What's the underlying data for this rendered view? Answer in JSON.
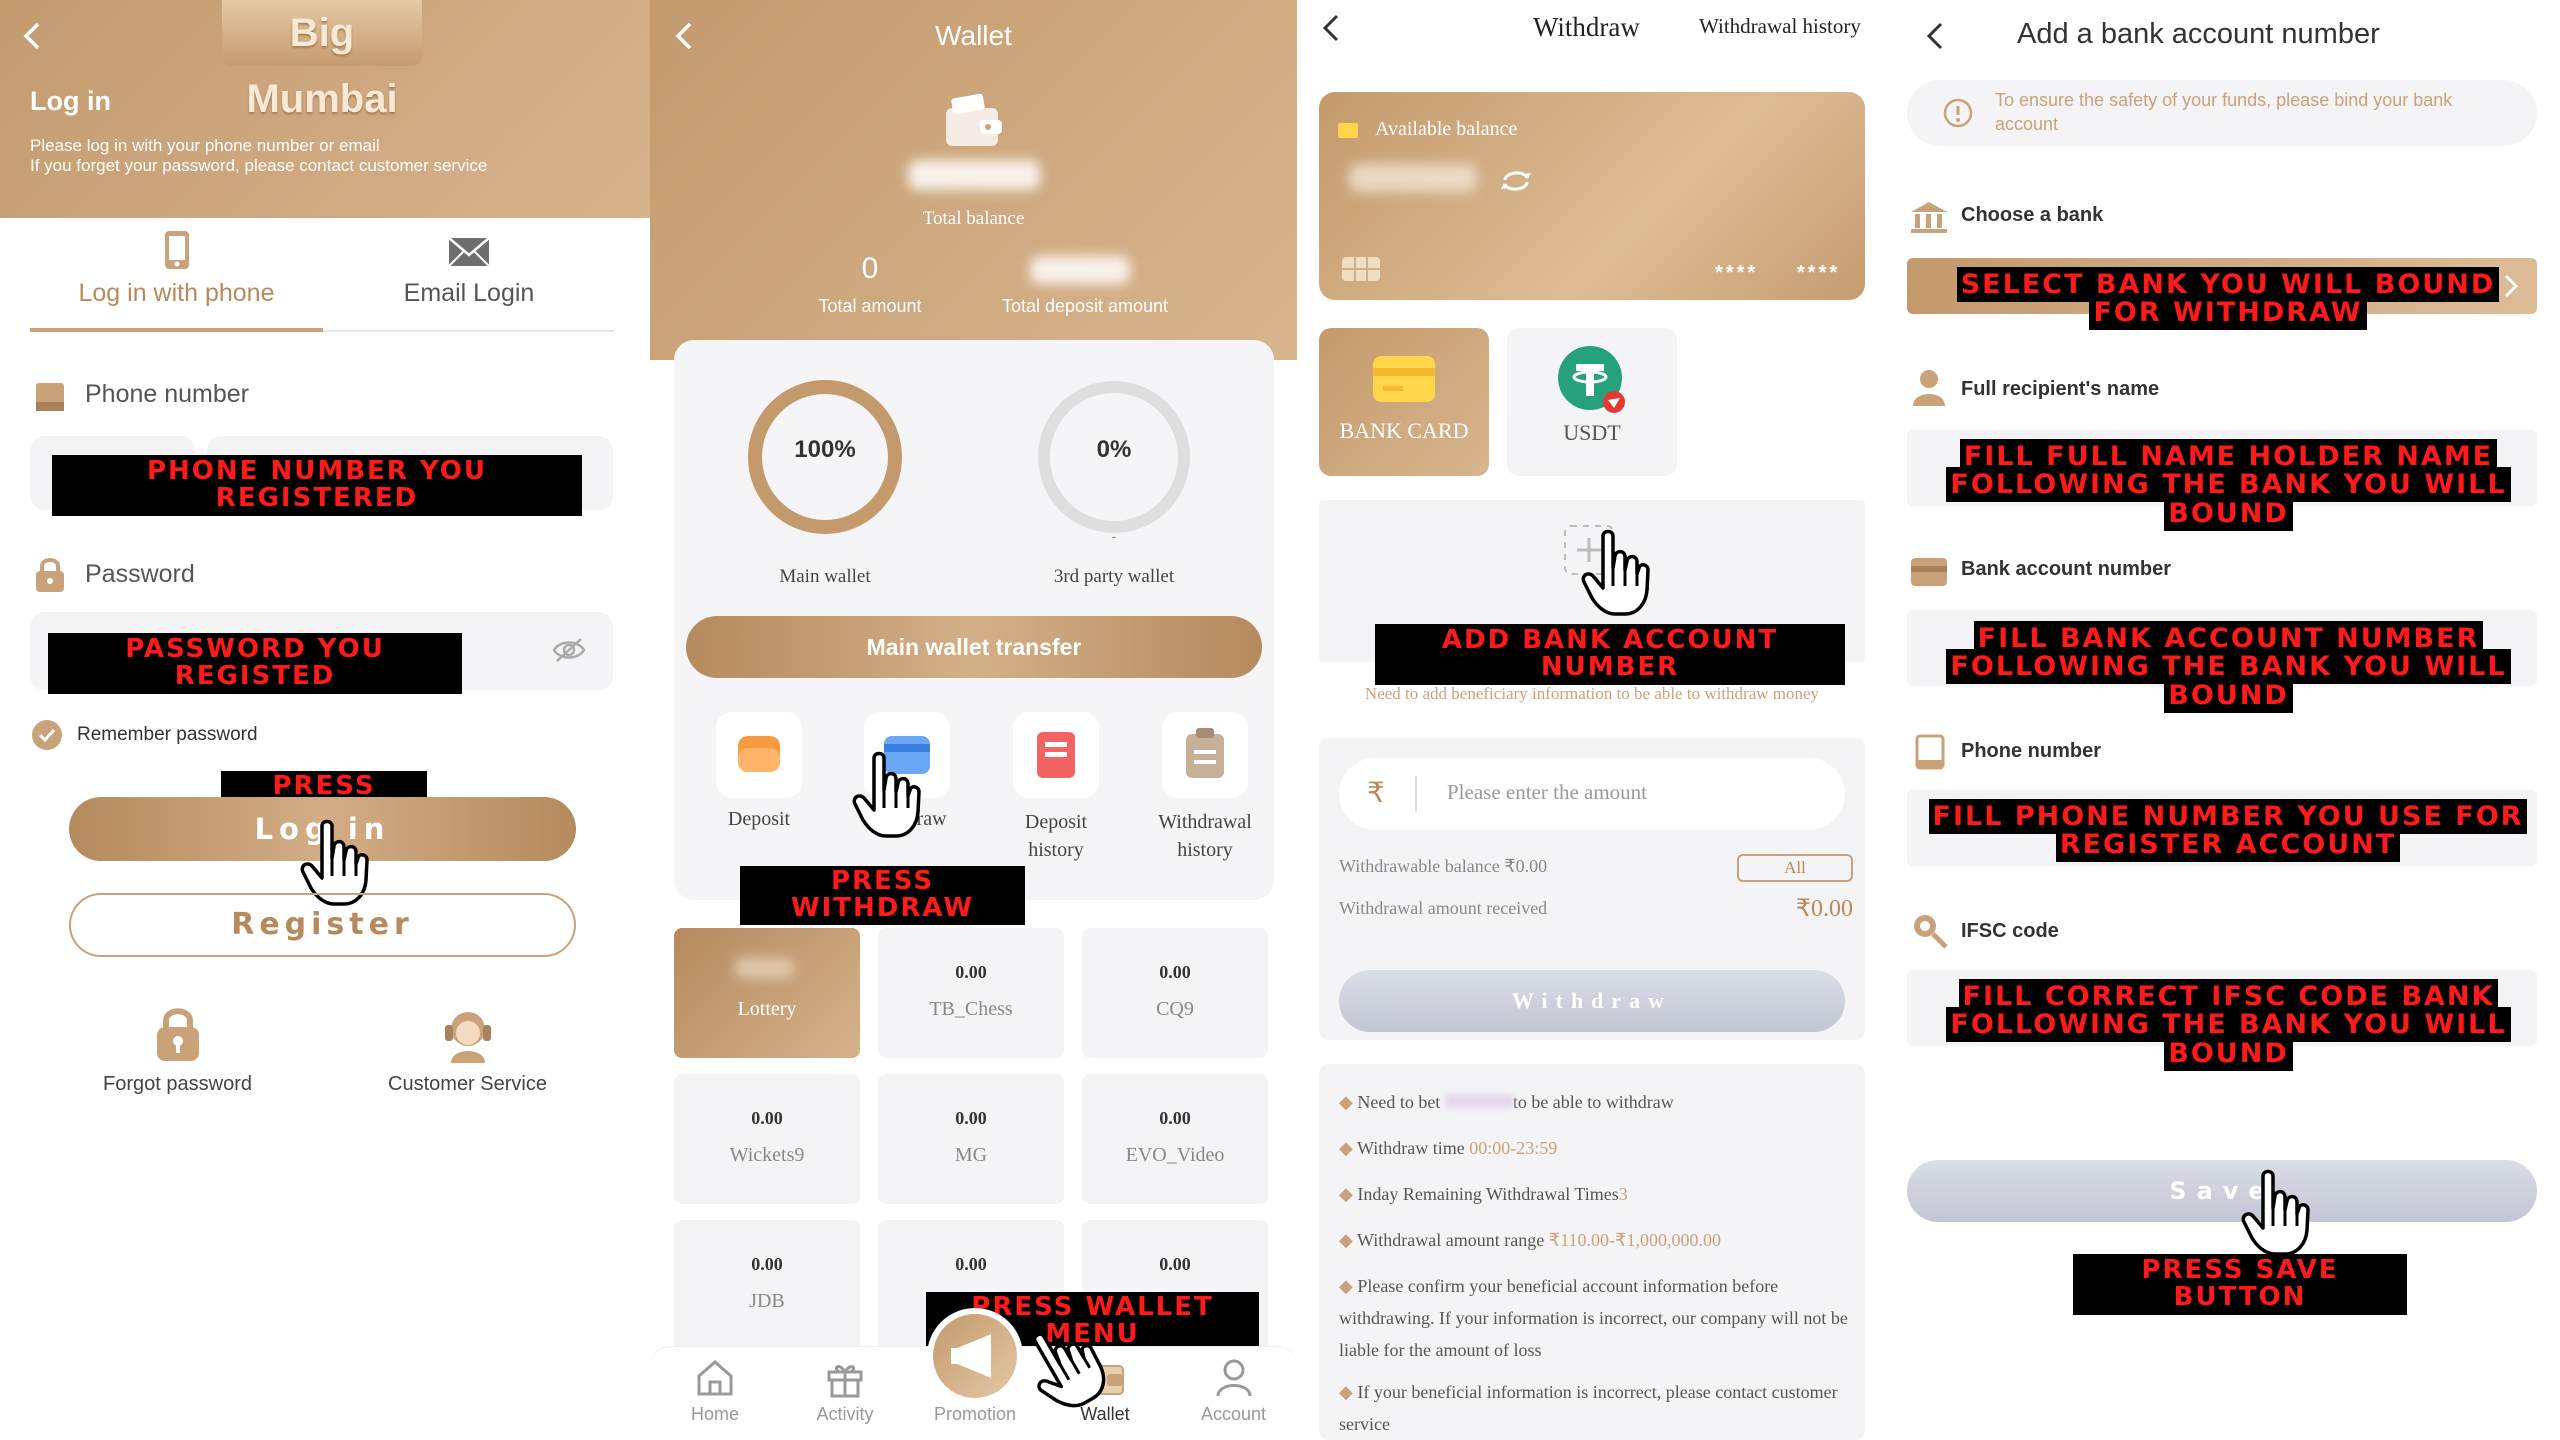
{
  "panel1": {
    "logo": "Big Mumbai",
    "title": "Log in",
    "subtitle1": "Please log in with your phone number or email",
    "subtitle2": "If you forget your password, please contact customer service",
    "tab_phone": "Log in with phone",
    "tab_email": "Email Login",
    "phone_label": "Phone number",
    "phone_note": "PHONE NUMBER YOU REGISTERED",
    "password_label": "Password",
    "password_note": "PASSWORD YOU REGISTED",
    "remember": "Remember password",
    "press_login_note": "PRESS LOGIN",
    "login_btn": "Log in",
    "register_btn": "Register",
    "forgot": "Forgot password",
    "service": "Customer Service"
  },
  "panel2": {
    "title": "Wallet",
    "total_balance": "Total balance",
    "total_amount_value": "0",
    "total_amount": "Total amount",
    "total_deposit": "Total deposit amount",
    "main_pct": "100%",
    "main_pct_value": 1.0,
    "third_pct": "0%",
    "third_pct_value": 0.0,
    "third_dash": "-",
    "main_wallet": "Main wallet",
    "third_wallet": "3rd party wallet",
    "transfer_btn": "Main wallet transfer",
    "actions": {
      "deposit": "Deposit",
      "withdraw": "Withdraw",
      "deposit_history": "Deposit history",
      "withdrawal_history": "Withdrawal history"
    },
    "press_withdraw_note": "PRESS WITHDRAW",
    "games": [
      {
        "value": "",
        "name": "Lottery"
      },
      {
        "value": "0.00",
        "name": "TB_Chess"
      },
      {
        "value": "0.00",
        "name": "CQ9"
      },
      {
        "value": "0.00",
        "name": "Wickets9"
      },
      {
        "value": "0.00",
        "name": "MG"
      },
      {
        "value": "0.00",
        "name": "EVO_Video"
      },
      {
        "value": "0.00",
        "name": "JDB"
      },
      {
        "value": "0.00",
        "name": ""
      },
      {
        "value": "0.00",
        "name": ""
      }
    ],
    "press_wallet_note": "PRESS WALLET MENU",
    "nav": {
      "home": "Home",
      "activity": "Activity",
      "promotion": "Promotion",
      "wallet": "Wallet",
      "account": "Account"
    }
  },
  "panel3": {
    "tab_withdraw": "Withdraw",
    "tab_history": "Withdrawal history",
    "available_balance": "Available balance",
    "card_dots1": "****",
    "card_dots2": "****",
    "bank_card": "BANK CARD",
    "usdt": "USDT",
    "add_note": "ADD BANK ACCOUNT NUMBER",
    "beneficiary_note": "Need to add beneficiary information to be able to withdraw money",
    "rupee": "₹",
    "amount_placeholder": "Please enter the amount",
    "withdrawable": "Withdrawable balance ₹0.00",
    "all_btn": "All",
    "received_label": "Withdrawal amount received",
    "received_value": "₹0.00",
    "withdraw_btn": "Withdraw",
    "rules": [
      {
        "pre": "Need to bet ",
        "hl": "",
        "post": "to be able to withdraw"
      },
      {
        "pre": "Withdraw time ",
        "hl": "00:00-23:59",
        "post": ""
      },
      {
        "pre": "Inday Remaining Withdrawal Times",
        "hl": "3",
        "post": ""
      },
      {
        "pre": "Withdrawal amount range ",
        "hl": "₹110.00-₹1,000,000.00",
        "post": ""
      },
      {
        "pre": "Please confirm your beneficial account information before withdrawing. If your information is incorrect, our company will not be liable for the amount of loss",
        "hl": "",
        "post": ""
      },
      {
        "pre": "If your beneficial information is incorrect, please contact customer service",
        "hl": "",
        "post": ""
      }
    ]
  },
  "panel4": {
    "title": "Add a bank account number",
    "notice": "To ensure the safety of your funds, please bind your bank account",
    "choose_bank": "Choose a bank",
    "bank_note": "SELECT BANK YOU WILL BOUND FOR WITHDRAW",
    "name_label": "Full recipient's name",
    "name_note": "FILL FULL NAME HOLDER NAME FOLLOWING THE BANK YOU WILL BOUND",
    "account_label": "Bank account number",
    "account_note": "FILL BANK ACCOUNT NUMBER FOLLOWING THE BANK YOU WILL BOUND",
    "phone_label": "Phone number",
    "phone_note": "FILL PHONE NUMBER YOU USE FOR REGISTER ACCOUNT",
    "ifsc_label": "IFSC code",
    "ifsc_note": "FILL CORRECT IFSC CODE BANK FOLLOWING THE BANK YOU WILL BOUND",
    "save_btn": "Save",
    "save_note": "PRESS SAVE BUTTON"
  },
  "colors": {
    "brand_gold": "#c9a27a",
    "gold_dark": "#b8895c",
    "annotation_red": "#ff1a1a",
    "annotation_bg": "#000000"
  }
}
